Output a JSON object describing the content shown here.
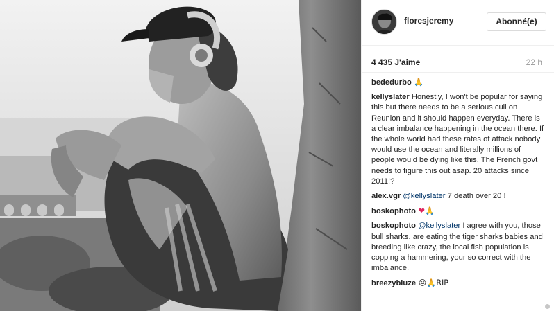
{
  "post": {
    "username": "floresjeremy",
    "follow_label": "Abonné(e)",
    "likes": "4 435 J'aime",
    "age": "22 h",
    "photo_alt": "Black and white photo of a shirtless surfer in a cap and headphones sitting against a rock"
  },
  "comments": [
    {
      "user": "bededurbo",
      "text": " 🙏"
    },
    {
      "user": "kellyslater",
      "text": " Honestly, I won't be popular for saying this but there needs to be a serious cull on Reunion and it should happen everyday. There is a clear imbalance happening in the ocean there. If the whole world had these rates of attack nobody would use the ocean and literally millions of people would be dying like this. The French govt needs to figure this out asap. 20 attacks since 2011!?"
    },
    {
      "user": "alex.vgr",
      "mention": " @kellyslater",
      "text": " 7 death over 20 !"
    },
    {
      "user": "boskophoto",
      "text": " ❤🙏"
    },
    {
      "user": "boskophoto",
      "mention": " @kellyslater",
      "text": " I agree with you, those bull sharks. are eating the tiger sharks babies and breeding like crazy, the local fish population is copping a hammering, your so correct with the imbalance."
    },
    {
      "user": "breezybluze",
      "text": " 😔🙏RIP"
    }
  ],
  "icons": {
    "avatar": "user-avatar",
    "scroll": "scroll-indicator"
  },
  "colors": {
    "border": "#efefef",
    "text": "#262626",
    "muted": "#999999",
    "mention": "#003569"
  }
}
